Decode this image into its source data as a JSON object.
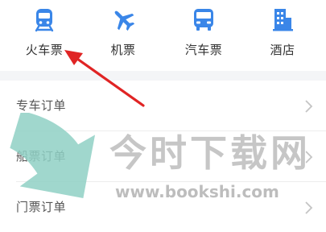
{
  "nav": {
    "items": [
      {
        "label": "火车票",
        "icon": "train-icon"
      },
      {
        "label": "机票",
        "icon": "airplane-icon"
      },
      {
        "label": "汽车票",
        "icon": "bus-icon"
      },
      {
        "label": "酒店",
        "icon": "hotel-icon"
      }
    ]
  },
  "menu": {
    "items": [
      {
        "label": "专车订单"
      },
      {
        "label": "船票订单"
      },
      {
        "label": "门票订单"
      }
    ]
  },
  "watermark": {
    "title": "今时下载网",
    "url": "www.bookshi.com"
  },
  "colors": {
    "accent": "#3a86e8",
    "annotation": "#e02424",
    "watermark_arrow": "#8fd0c4",
    "background_gap": "#f4f5f7"
  }
}
